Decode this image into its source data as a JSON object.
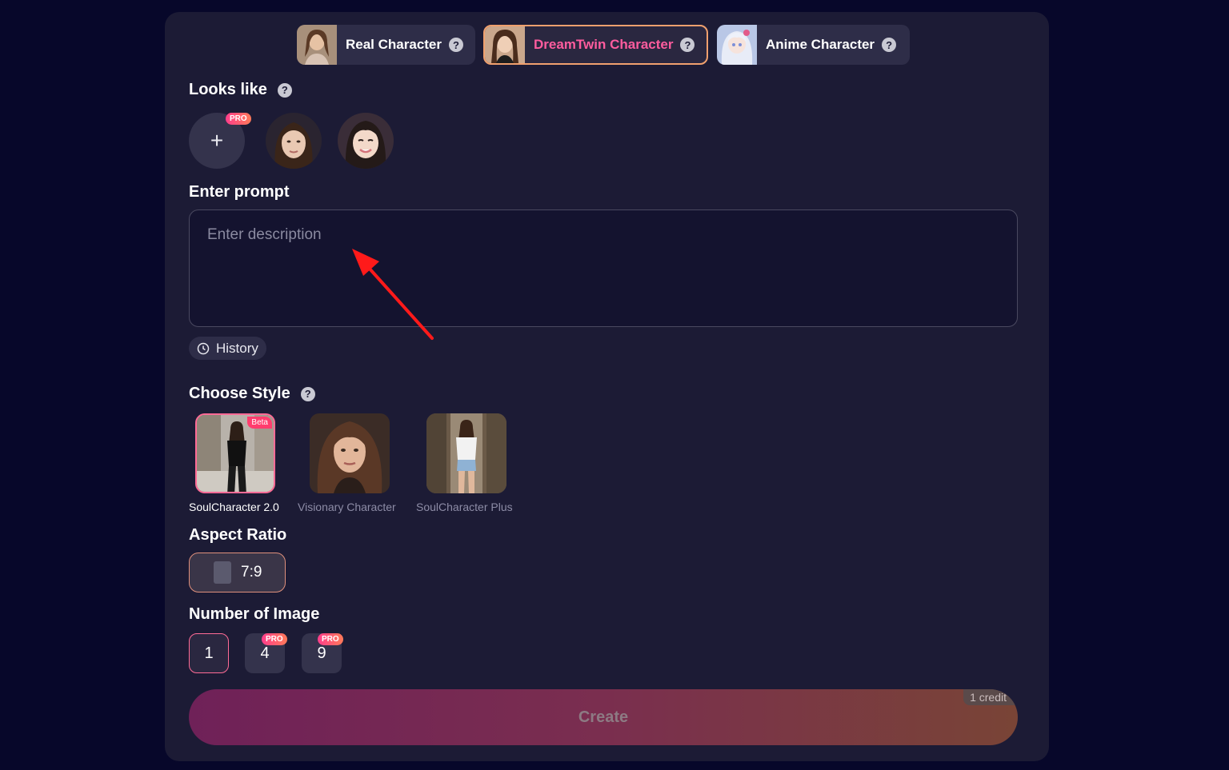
{
  "tabs": [
    {
      "label": "Real Character",
      "help": "?"
    },
    {
      "label": "DreamTwin Character",
      "help": "?"
    },
    {
      "label": "Anime Character",
      "help": "?"
    }
  ],
  "looks_like": {
    "title": "Looks like",
    "help": "?",
    "add_symbol": "+",
    "pro_badge": "PRO"
  },
  "prompt": {
    "title": "Enter prompt",
    "placeholder": "Enter description",
    "value": ""
  },
  "history": {
    "label": "History"
  },
  "style": {
    "title": "Choose Style",
    "help": "?",
    "items": [
      {
        "label": "SoulCharacter 2.0",
        "badge": "Beta"
      },
      {
        "label": "Visionary Character"
      },
      {
        "label": "SoulCharacter Plus"
      }
    ]
  },
  "aspect": {
    "title": "Aspect Ratio",
    "value": "7:9"
  },
  "number": {
    "title": "Number of Image",
    "options": [
      {
        "label": "1"
      },
      {
        "label": "4",
        "badge": "PRO"
      },
      {
        "label": "9",
        "badge": "PRO"
      }
    ]
  },
  "create": {
    "label": "Create",
    "credit": "1 credit"
  },
  "colors": {
    "accent_pink": "#ff5c9e",
    "accent_orange": "#f0a06e",
    "panel_bg": "#1c1b35",
    "page_bg": "#07072a"
  }
}
